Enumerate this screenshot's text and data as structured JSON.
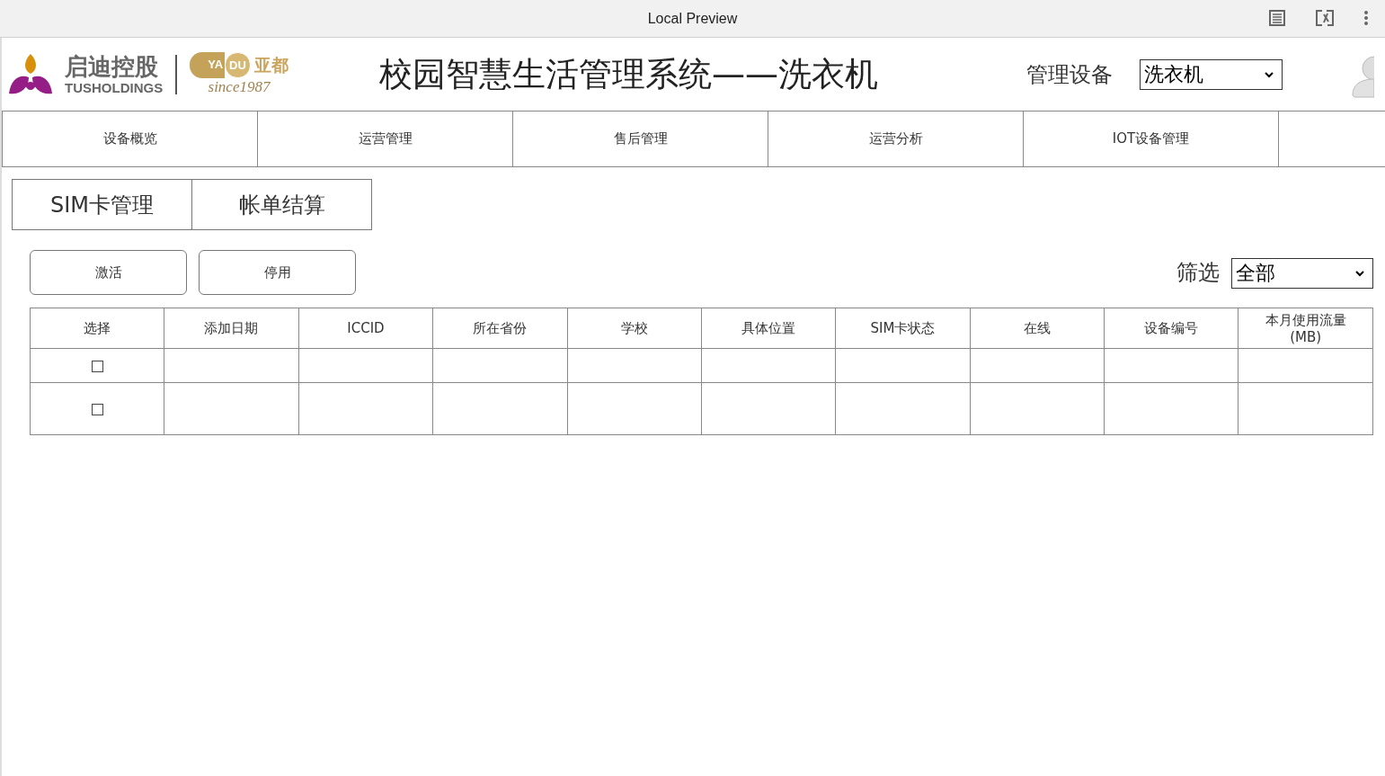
{
  "browser_bar": {
    "title": "Local Preview"
  },
  "header": {
    "brand_cn": "启迪控股",
    "brand_en": "TUSHOLDINGS",
    "partner_mark": [
      "YA",
      "DU"
    ],
    "partner_cn": "亚都",
    "partner_since": "since1987",
    "title": "校园智慧生活管理系统——洗衣机",
    "device_label": "管理设备",
    "device_select": "洗衣机"
  },
  "nav_tabs": [
    {
      "label": "设备概览",
      "selected": false
    },
    {
      "label": "运营管理",
      "selected": false
    },
    {
      "label": "售后管理",
      "selected": false
    },
    {
      "label": "运营分析",
      "selected": false
    },
    {
      "label": "IOT设备管理",
      "selected": false
    },
    {
      "selected": false
    }
  ],
  "sub_tabs": [
    {
      "label": "SIM卡管理",
      "selected": false
    },
    {
      "label": "帐单结算",
      "selected": false
    }
  ],
  "actions": [
    "激活",
    "停用"
  ],
  "filter": {
    "label": "筛选",
    "value": "全部"
  },
  "table": {
    "columns": [
      "选择",
      "添加日期",
      "ICCID",
      "所在省份",
      "学校",
      "具体位置",
      "SIM卡状态",
      "在线",
      "设备编号",
      "本月使用流量\n(MB)"
    ],
    "rows": [
      {
        "checked": false
      },
      {
        "checked": false
      }
    ]
  }
}
